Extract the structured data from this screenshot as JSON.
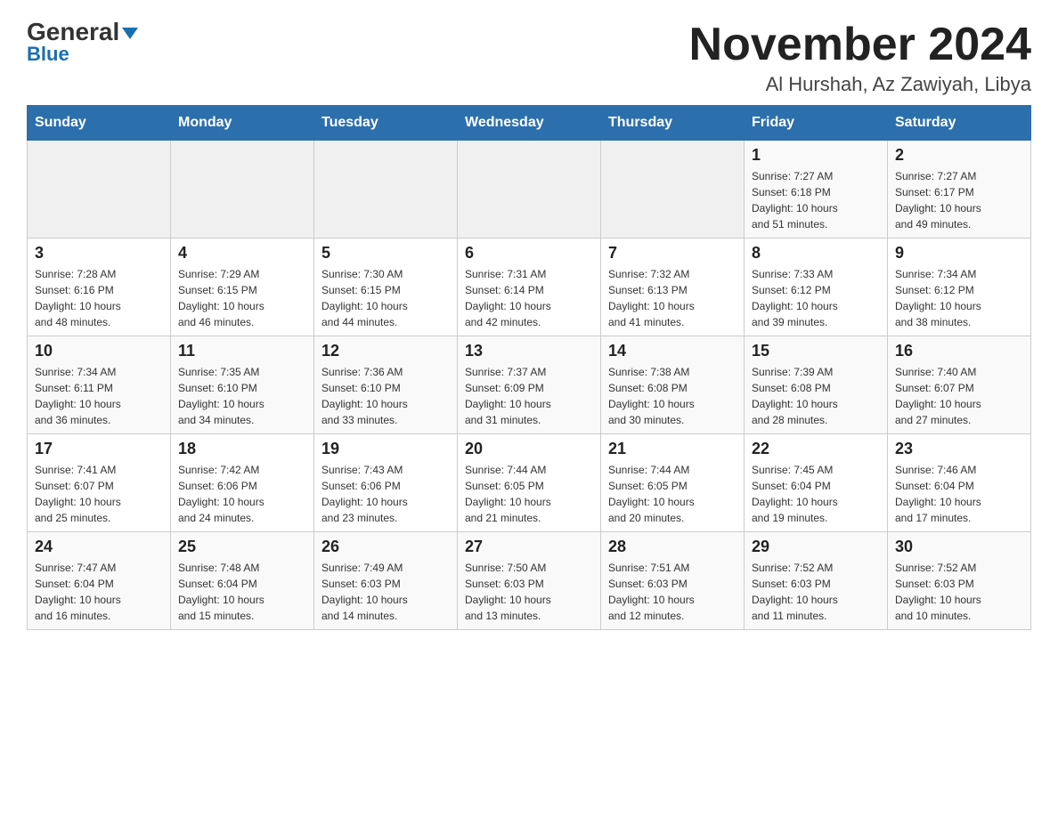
{
  "header": {
    "logo_main": "General",
    "logo_sub": "Blue",
    "title": "November 2024",
    "subtitle": "Al Hurshah, Az Zawiyah, Libya"
  },
  "calendar": {
    "days_of_week": [
      "Sunday",
      "Monday",
      "Tuesday",
      "Wednesday",
      "Thursday",
      "Friday",
      "Saturday"
    ],
    "weeks": [
      [
        {
          "day": "",
          "info": ""
        },
        {
          "day": "",
          "info": ""
        },
        {
          "day": "",
          "info": ""
        },
        {
          "day": "",
          "info": ""
        },
        {
          "day": "",
          "info": ""
        },
        {
          "day": "1",
          "info": "Sunrise: 7:27 AM\nSunset: 6:18 PM\nDaylight: 10 hours\nand 51 minutes."
        },
        {
          "day": "2",
          "info": "Sunrise: 7:27 AM\nSunset: 6:17 PM\nDaylight: 10 hours\nand 49 minutes."
        }
      ],
      [
        {
          "day": "3",
          "info": "Sunrise: 7:28 AM\nSunset: 6:16 PM\nDaylight: 10 hours\nand 48 minutes."
        },
        {
          "day": "4",
          "info": "Sunrise: 7:29 AM\nSunset: 6:15 PM\nDaylight: 10 hours\nand 46 minutes."
        },
        {
          "day": "5",
          "info": "Sunrise: 7:30 AM\nSunset: 6:15 PM\nDaylight: 10 hours\nand 44 minutes."
        },
        {
          "day": "6",
          "info": "Sunrise: 7:31 AM\nSunset: 6:14 PM\nDaylight: 10 hours\nand 42 minutes."
        },
        {
          "day": "7",
          "info": "Sunrise: 7:32 AM\nSunset: 6:13 PM\nDaylight: 10 hours\nand 41 minutes."
        },
        {
          "day": "8",
          "info": "Sunrise: 7:33 AM\nSunset: 6:12 PM\nDaylight: 10 hours\nand 39 minutes."
        },
        {
          "day": "9",
          "info": "Sunrise: 7:34 AM\nSunset: 6:12 PM\nDaylight: 10 hours\nand 38 minutes."
        }
      ],
      [
        {
          "day": "10",
          "info": "Sunrise: 7:34 AM\nSunset: 6:11 PM\nDaylight: 10 hours\nand 36 minutes."
        },
        {
          "day": "11",
          "info": "Sunrise: 7:35 AM\nSunset: 6:10 PM\nDaylight: 10 hours\nand 34 minutes."
        },
        {
          "day": "12",
          "info": "Sunrise: 7:36 AM\nSunset: 6:10 PM\nDaylight: 10 hours\nand 33 minutes."
        },
        {
          "day": "13",
          "info": "Sunrise: 7:37 AM\nSunset: 6:09 PM\nDaylight: 10 hours\nand 31 minutes."
        },
        {
          "day": "14",
          "info": "Sunrise: 7:38 AM\nSunset: 6:08 PM\nDaylight: 10 hours\nand 30 minutes."
        },
        {
          "day": "15",
          "info": "Sunrise: 7:39 AM\nSunset: 6:08 PM\nDaylight: 10 hours\nand 28 minutes."
        },
        {
          "day": "16",
          "info": "Sunrise: 7:40 AM\nSunset: 6:07 PM\nDaylight: 10 hours\nand 27 minutes."
        }
      ],
      [
        {
          "day": "17",
          "info": "Sunrise: 7:41 AM\nSunset: 6:07 PM\nDaylight: 10 hours\nand 25 minutes."
        },
        {
          "day": "18",
          "info": "Sunrise: 7:42 AM\nSunset: 6:06 PM\nDaylight: 10 hours\nand 24 minutes."
        },
        {
          "day": "19",
          "info": "Sunrise: 7:43 AM\nSunset: 6:06 PM\nDaylight: 10 hours\nand 23 minutes."
        },
        {
          "day": "20",
          "info": "Sunrise: 7:44 AM\nSunset: 6:05 PM\nDaylight: 10 hours\nand 21 minutes."
        },
        {
          "day": "21",
          "info": "Sunrise: 7:44 AM\nSunset: 6:05 PM\nDaylight: 10 hours\nand 20 minutes."
        },
        {
          "day": "22",
          "info": "Sunrise: 7:45 AM\nSunset: 6:04 PM\nDaylight: 10 hours\nand 19 minutes."
        },
        {
          "day": "23",
          "info": "Sunrise: 7:46 AM\nSunset: 6:04 PM\nDaylight: 10 hours\nand 17 minutes."
        }
      ],
      [
        {
          "day": "24",
          "info": "Sunrise: 7:47 AM\nSunset: 6:04 PM\nDaylight: 10 hours\nand 16 minutes."
        },
        {
          "day": "25",
          "info": "Sunrise: 7:48 AM\nSunset: 6:04 PM\nDaylight: 10 hours\nand 15 minutes."
        },
        {
          "day": "26",
          "info": "Sunrise: 7:49 AM\nSunset: 6:03 PM\nDaylight: 10 hours\nand 14 minutes."
        },
        {
          "day": "27",
          "info": "Sunrise: 7:50 AM\nSunset: 6:03 PM\nDaylight: 10 hours\nand 13 minutes."
        },
        {
          "day": "28",
          "info": "Sunrise: 7:51 AM\nSunset: 6:03 PM\nDaylight: 10 hours\nand 12 minutes."
        },
        {
          "day": "29",
          "info": "Sunrise: 7:52 AM\nSunset: 6:03 PM\nDaylight: 10 hours\nand 11 minutes."
        },
        {
          "day": "30",
          "info": "Sunrise: 7:52 AM\nSunset: 6:03 PM\nDaylight: 10 hours\nand 10 minutes."
        }
      ]
    ]
  }
}
